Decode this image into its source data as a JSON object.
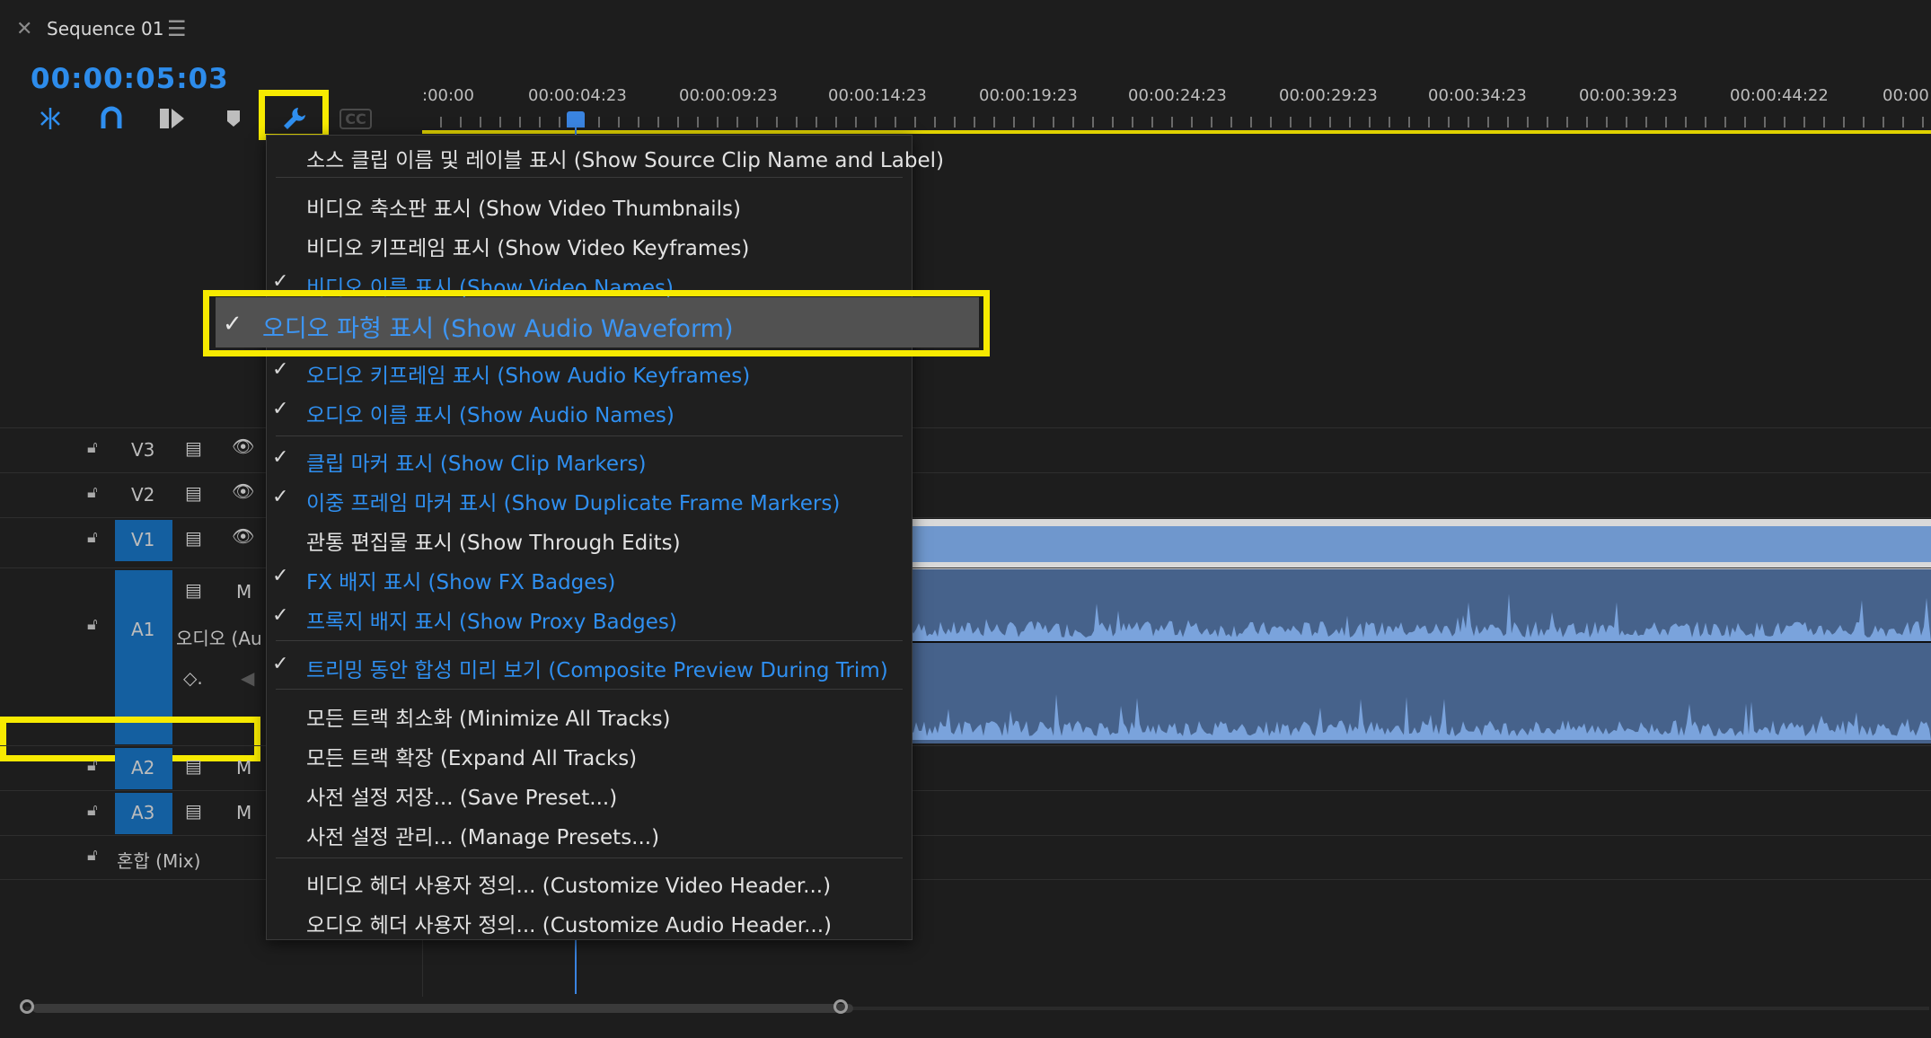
{
  "tab": {
    "close_icon": "close-icon",
    "title": "Sequence 01",
    "menu_icon": "hamburger-menu-icon"
  },
  "timecode": "00:00:05:03",
  "toolbar": {
    "tools": [
      "snap-icon",
      "magnet-linked-selection-icon",
      "insert-overwrite-icon",
      "add-marker-icon",
      "wrench-settings-icon",
      "captions-icon"
    ],
    "captions_label": "CC"
  },
  "ruler": {
    "labels": [
      ":00:00",
      "00:00:04:23",
      "00:00:09:23",
      "00:00:14:23",
      "00:00:19:23",
      "00:00:24:23",
      "00:00:29:23",
      "00:00:34:23",
      "00:00:39:23",
      "00:00:44:22",
      "00:00:"
    ]
  },
  "tracks": {
    "video": [
      {
        "name": "V3"
      },
      {
        "name": "V2"
      },
      {
        "name": "V1"
      }
    ],
    "audio": [
      {
        "name": "A1",
        "sublabel": "오디오 (Au",
        "m": "M"
      },
      {
        "name": "A2",
        "m": "M"
      },
      {
        "name": "A3",
        "m": "M"
      }
    ],
    "mix": "혼합 (Mix)"
  },
  "menu": {
    "items": [
      {
        "label": "소스 클립 이름 및 레이블 표시 (Show Source Clip Name and Label)",
        "checked": false
      },
      {
        "label": "비디오 축소판 표시 (Show Video Thumbnails)",
        "checked": false
      },
      {
        "label": "비디오 키프레임 표시 (Show Video Keyframes)",
        "checked": false
      },
      {
        "label": "비디오 이름 표시 (Show Video Names)",
        "checked": true
      },
      {
        "label": "오디오 파형 표시 (Show Audio Waveform)",
        "checked": true
      },
      {
        "label": "오디오 키프레임 표시 (Show Audio Keyframes)",
        "checked": true
      },
      {
        "label": "오디오 이름 표시 (Show Audio Names)",
        "checked": true
      },
      {
        "label": "클립 마커 표시 (Show Clip Markers)",
        "checked": true
      },
      {
        "label": "이중 프레임 마커 표시 (Show Duplicate Frame Markers)",
        "checked": true
      },
      {
        "label": "관통 편집물 표시 (Show Through Edits)",
        "checked": false
      },
      {
        "label": "FX 배지 표시 (Show FX Badges)",
        "checked": true
      },
      {
        "label": "프록지 배지 표시 (Show Proxy Badges)",
        "checked": true
      },
      {
        "label": "트리밍 동안 합성 미리 보기 (Composite Preview During Trim)",
        "checked": true
      },
      {
        "label": "모든 트랙 최소화 (Minimize All Tracks)",
        "checked": false
      },
      {
        "label": "모든 트랙 확장 (Expand All Tracks)",
        "checked": false
      },
      {
        "label": "사전 설정 저장... (Save Preset...)",
        "checked": false
      },
      {
        "label": "사전 설정 관리... (Manage Presets...)",
        "checked": false
      },
      {
        "label": "비디오 헤더 사용자 정의... (Customize Video Header...)",
        "checked": false
      },
      {
        "label": "오디오 헤더 사용자 정의... (Customize Audio Header...)",
        "checked": false
      }
    ]
  },
  "colors": {
    "accent": "#2d8ceb",
    "highlight": "#f7ea00",
    "clip_video": "#6f97cd",
    "clip_audio": "#46628b",
    "track_selected": "#145fa0"
  }
}
